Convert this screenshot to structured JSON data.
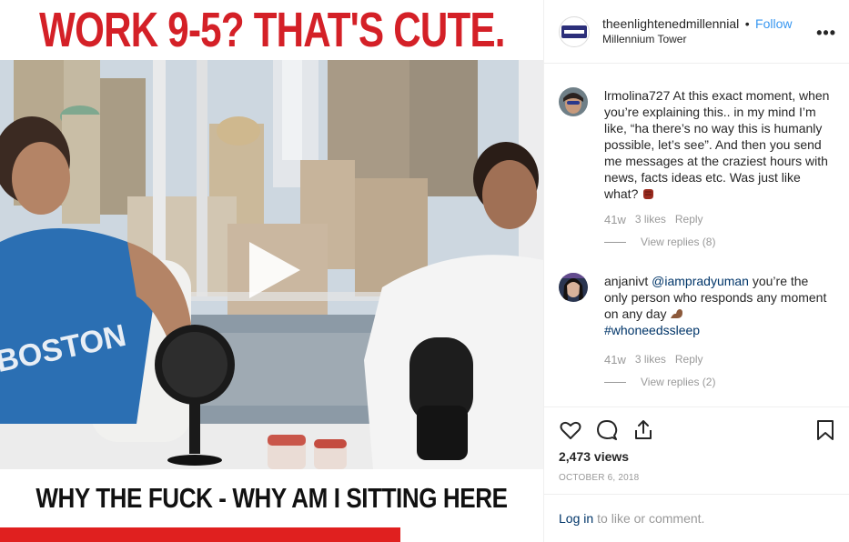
{
  "video": {
    "top_caption": "WORK 9-5? THAT'S CUTE.",
    "bottom_caption": "WHY THE FUCK - WHY AM I SITTING HERE",
    "shirt_text": "BOSTON"
  },
  "header": {
    "username": "theenlightenedmillennial",
    "separator": "•",
    "follow_label": "Follow",
    "location": "Millennium Tower",
    "more_label": "•••"
  },
  "comments": [
    {
      "username": "lrmolina727",
      "text": "At this exact moment, when you’re explaining this.. in my mind I’m like, “ha there’s no way this is humanly possible, let’s see”. And then you send me messages at the craziest hours with news, facts ideas etc. Was just like what?",
      "emoji": "fist-emoji",
      "time": "41w",
      "likes": "3 likes",
      "reply_label": "Reply",
      "view_replies": "View replies (8)"
    },
    {
      "username": "anjanivt",
      "mention": "@iampradyuman",
      "text_after_mention": " you’re the only person who responds any moment on any day",
      "emoji": "flexed-bicep-emoji",
      "hashtag": "#whoneedssleep",
      "time": "41w",
      "likes": "3 likes",
      "reply_label": "Reply",
      "view_replies": "View replies (2)"
    }
  ],
  "actions": {
    "views": "2,473 views",
    "date": "OCTOBER 6, 2018"
  },
  "login": {
    "link_label": "Log in",
    "rest": "to like or comment."
  },
  "colors": {
    "caption_red": "#d42027",
    "follow_blue": "#3897f0",
    "link_navy": "#003569",
    "muted_gray": "#999999"
  }
}
